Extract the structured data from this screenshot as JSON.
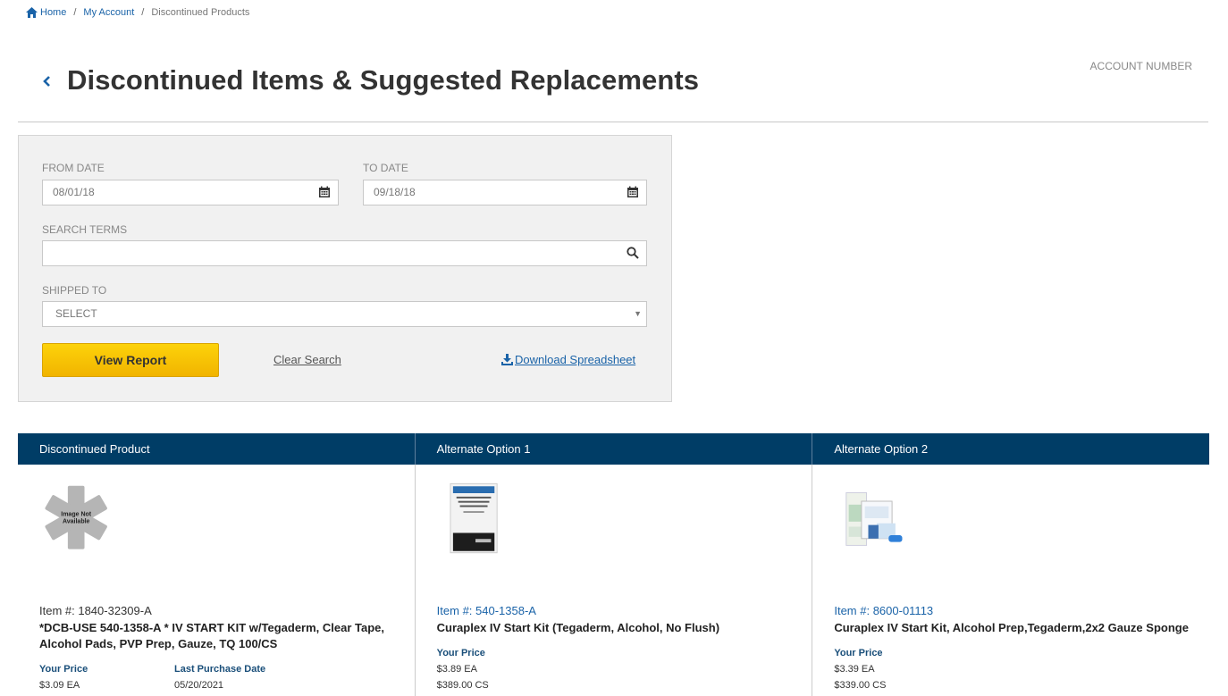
{
  "breadcrumb": {
    "home": "Home",
    "my_account": "My Account",
    "current": "Discontinued Products"
  },
  "header": {
    "title": "Discontinued Items & Suggested Replacements",
    "account_label": "ACCOUNT NUMBER"
  },
  "filters": {
    "from_date_label": "FROM DATE",
    "from_date_value": "08/01/18",
    "to_date_label": "TO DATE",
    "to_date_value": "09/18/18",
    "search_label": "SEARCH TERMS",
    "search_value": "",
    "shipped_label": "SHIPPED TO",
    "shipped_value": "SELECT",
    "view_report": "View Report",
    "clear_search": "Clear Search",
    "download": "Download Spreadsheet"
  },
  "results": {
    "columns": [
      "Discontinued Product",
      "Alternate Option 1",
      "Alternate Option 2"
    ],
    "discontinued": {
      "image_text_1": "Image Not",
      "image_text_2": "Available",
      "item_num": "Item #: 1840-32309-A",
      "name": "*DCB-USE 540-1358-A * IV START KIT w/Tegaderm, Clear Tape, Alcohol Pads, PVP Prep, Gauze, TQ 100/CS",
      "your_price_label": "Your Price",
      "price_ea": "$3.09 EA",
      "last_purchase_label": "Last Purchase Date",
      "last_purchase_date": "05/20/2021"
    },
    "alt1": {
      "item_num": "Item #: 540-1358-A",
      "name": "Curaplex IV Start Kit (Tegaderm, Alcohol, No Flush)",
      "your_price_label": "Your Price",
      "price_ea": "$3.89 EA",
      "price_cs": "$389.00 CS"
    },
    "alt2": {
      "item_num": "Item #: 8600-01113",
      "name": "Curaplex IV Start Kit, Alcohol Prep,Tegaderm,2x2 Gauze Sponge",
      "your_price_label": "Your Price",
      "price_ea": "$3.39 EA",
      "price_cs": "$339.00 CS"
    }
  }
}
